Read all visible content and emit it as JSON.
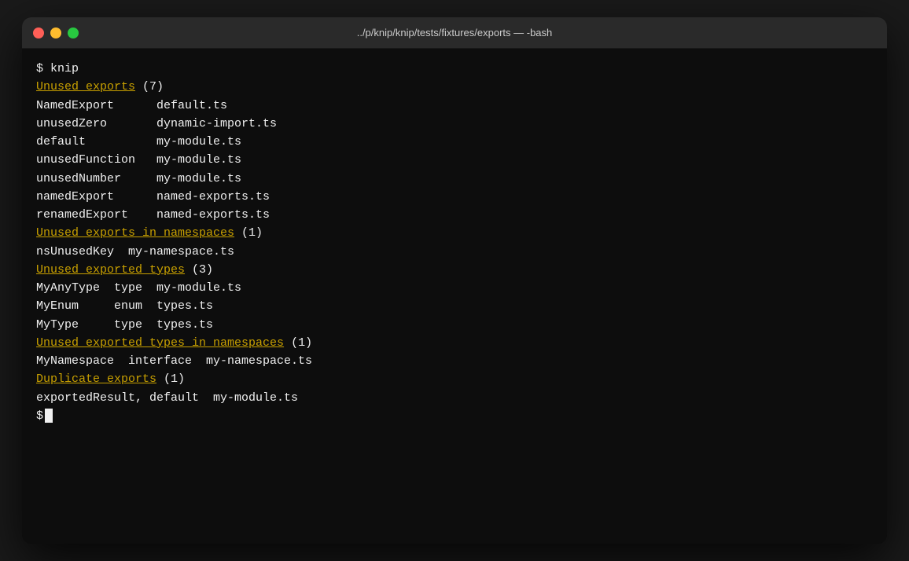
{
  "window": {
    "title": "../p/knip/knip/tests/fixtures/exports — -bash"
  },
  "terminal": {
    "command": "$ knip",
    "sections": [
      {
        "id": "unused-exports",
        "header": "Unused exports",
        "count": "(7)",
        "rows": [
          "NamedExport      default.ts",
          "unusedZero       dynamic-import.ts",
          "default          my-module.ts",
          "unusedFunction   my-module.ts",
          "unusedNumber     my-module.ts",
          "namedExport      named-exports.ts",
          "renamedExport    named-exports.ts"
        ]
      },
      {
        "id": "unused-exports-in-namespaces",
        "header": "Unused exports in namespaces",
        "count": "(1)",
        "rows": [
          "nsUnusedKey  my-namespace.ts"
        ]
      },
      {
        "id": "unused-exported-types",
        "header": "Unused exported types",
        "count": "(3)",
        "rows": [
          "MyAnyType  type  my-module.ts",
          "MyEnum     enum  types.ts",
          "MyType     type  types.ts"
        ]
      },
      {
        "id": "unused-exported-types-in-namespaces",
        "header": "Unused exported types in namespaces",
        "count": "(1)",
        "rows": [
          "MyNamespace  interface  my-namespace.ts"
        ]
      },
      {
        "id": "duplicate-exports",
        "header": "Duplicate exports",
        "count": "(1)",
        "rows": [
          "exportedResult, default  my-module.ts"
        ]
      }
    ],
    "prompt": "$"
  }
}
